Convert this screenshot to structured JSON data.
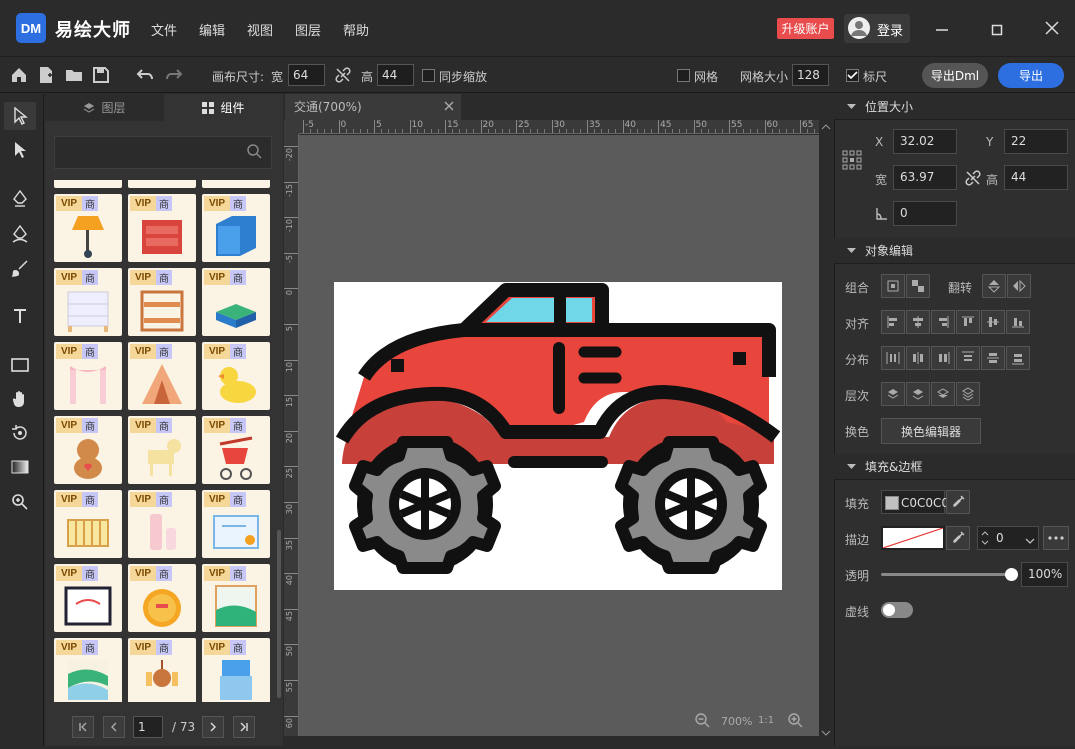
{
  "app": {
    "logo": "DM",
    "name": "易绘大师"
  },
  "menu": [
    "文件",
    "编辑",
    "视图",
    "图层",
    "帮助"
  ],
  "header": {
    "upgrade": "升级账户",
    "login": "登录"
  },
  "toolbar": {
    "canvas_size_label": "画布尺寸:",
    "width_label": "宽",
    "width_value": "64",
    "height_label": "高",
    "height_value": "44",
    "sync_zoom": "同步缩放",
    "grid": "网格",
    "grid_size_label": "网格大小",
    "grid_size_value": "128",
    "ruler": "标尺",
    "export_dml": "导出Dml",
    "export": "导出"
  },
  "left_panel": {
    "tabs": [
      "图层",
      "组件"
    ],
    "search_placeholder": "",
    "badge_vip": "VIP",
    "badge_shang": "商",
    "components": [
      "desk-lamp",
      "red-dresser",
      "blue-cabinet",
      "white-dresser",
      "bunk-bed",
      "bed",
      "canopy-curtain",
      "teepee-tent",
      "rubber-duck",
      "teddy-bear",
      "rocking-horse",
      "stroller",
      "baby-crib",
      "baby-bottles",
      "certificate",
      "photo-frame",
      "gold-medal",
      "landscape-painting",
      "landscape-painting-2",
      "chandelier",
      "water-dispenser"
    ],
    "pager": {
      "page": "1",
      "total": "/ 73"
    }
  },
  "document": {
    "tab": "交通(700%)",
    "zoom": "700%",
    "ratio": "1:1"
  },
  "ruler_top": [
    "-5",
    "0",
    "5",
    "10",
    "15",
    "20",
    "25",
    "30",
    "35",
    "40",
    "45",
    "50",
    "55",
    "60",
    "65"
  ],
  "ruler_left": [
    "-20",
    "-15",
    "-10",
    "-5",
    "0",
    "5",
    "10",
    "15",
    "20",
    "25",
    "30",
    "35",
    "40",
    "45",
    "50",
    "55",
    "60"
  ],
  "right_panel": {
    "pos_section": "位置大小",
    "x_label": "X",
    "x_value": "32.02",
    "y_label": "Y",
    "y_value": "22",
    "w_label": "宽",
    "w_value": "63.97",
    "h_label": "高",
    "h_value": "44",
    "angle_value": "0",
    "obj_section": "对象编辑",
    "group_label": "组合",
    "flip_label": "翻转",
    "align_label": "对齐",
    "dist_label": "分布",
    "layer_label": "层次",
    "color_label": "换色",
    "color_button": "换色编辑器",
    "fill_section": "填充&边框",
    "fill_label": "填充",
    "fill_value": "C0C0C0",
    "stroke_label": "描边",
    "stroke_width": "0",
    "opacity_label": "透明",
    "opacity_value": "100%",
    "dash_label": "虚线"
  }
}
